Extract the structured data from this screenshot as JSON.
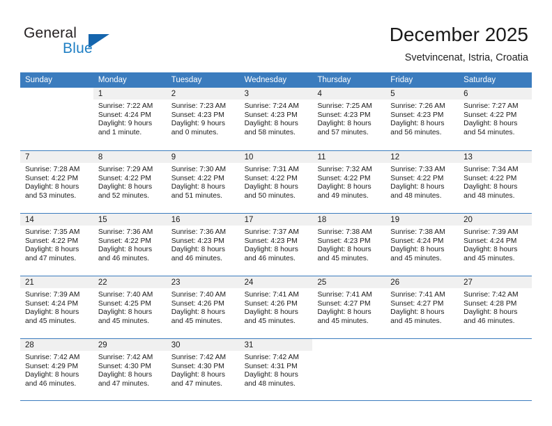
{
  "logo": {
    "word1": "General",
    "word2": "Blue",
    "triangle_color": "#1565ad",
    "blue_text_color": "#1f7fc4"
  },
  "header": {
    "title": "December 2025",
    "subtitle": "Svetvincenat, Istria, Croatia"
  },
  "theme": {
    "header_blue": "#3b7cbe",
    "daynum_band": "#f0f0f0",
    "text": "#1a1a1a"
  },
  "weekday_headers": [
    "Sunday",
    "Monday",
    "Tuesday",
    "Wednesday",
    "Thursday",
    "Friday",
    "Saturday"
  ],
  "labels": {
    "sunrise": "Sunrise:",
    "sunset": "Sunset:",
    "daylight": "Daylight:"
  },
  "weeks": [
    [
      {
        "day": "",
        "lines": []
      },
      {
        "day": "1",
        "lines": [
          "Sunrise: 7:22 AM",
          "Sunset: 4:24 PM",
          "Daylight: 9 hours",
          "and 1 minute."
        ]
      },
      {
        "day": "2",
        "lines": [
          "Sunrise: 7:23 AM",
          "Sunset: 4:23 PM",
          "Daylight: 9 hours",
          "and 0 minutes."
        ]
      },
      {
        "day": "3",
        "lines": [
          "Sunrise: 7:24 AM",
          "Sunset: 4:23 PM",
          "Daylight: 8 hours",
          "and 58 minutes."
        ]
      },
      {
        "day": "4",
        "lines": [
          "Sunrise: 7:25 AM",
          "Sunset: 4:23 PM",
          "Daylight: 8 hours",
          "and 57 minutes."
        ]
      },
      {
        "day": "5",
        "lines": [
          "Sunrise: 7:26 AM",
          "Sunset: 4:23 PM",
          "Daylight: 8 hours",
          "and 56 minutes."
        ]
      },
      {
        "day": "6",
        "lines": [
          "Sunrise: 7:27 AM",
          "Sunset: 4:22 PM",
          "Daylight: 8 hours",
          "and 54 minutes."
        ]
      }
    ],
    [
      {
        "day": "7",
        "lines": [
          "Sunrise: 7:28 AM",
          "Sunset: 4:22 PM",
          "Daylight: 8 hours",
          "and 53 minutes."
        ]
      },
      {
        "day": "8",
        "lines": [
          "Sunrise: 7:29 AM",
          "Sunset: 4:22 PM",
          "Daylight: 8 hours",
          "and 52 minutes."
        ]
      },
      {
        "day": "9",
        "lines": [
          "Sunrise: 7:30 AM",
          "Sunset: 4:22 PM",
          "Daylight: 8 hours",
          "and 51 minutes."
        ]
      },
      {
        "day": "10",
        "lines": [
          "Sunrise: 7:31 AM",
          "Sunset: 4:22 PM",
          "Daylight: 8 hours",
          "and 50 minutes."
        ]
      },
      {
        "day": "11",
        "lines": [
          "Sunrise: 7:32 AM",
          "Sunset: 4:22 PM",
          "Daylight: 8 hours",
          "and 49 minutes."
        ]
      },
      {
        "day": "12",
        "lines": [
          "Sunrise: 7:33 AM",
          "Sunset: 4:22 PM",
          "Daylight: 8 hours",
          "and 48 minutes."
        ]
      },
      {
        "day": "13",
        "lines": [
          "Sunrise: 7:34 AM",
          "Sunset: 4:22 PM",
          "Daylight: 8 hours",
          "and 48 minutes."
        ]
      }
    ],
    [
      {
        "day": "14",
        "lines": [
          "Sunrise: 7:35 AM",
          "Sunset: 4:22 PM",
          "Daylight: 8 hours",
          "and 47 minutes."
        ]
      },
      {
        "day": "15",
        "lines": [
          "Sunrise: 7:36 AM",
          "Sunset: 4:22 PM",
          "Daylight: 8 hours",
          "and 46 minutes."
        ]
      },
      {
        "day": "16",
        "lines": [
          "Sunrise: 7:36 AM",
          "Sunset: 4:23 PM",
          "Daylight: 8 hours",
          "and 46 minutes."
        ]
      },
      {
        "day": "17",
        "lines": [
          "Sunrise: 7:37 AM",
          "Sunset: 4:23 PM",
          "Daylight: 8 hours",
          "and 46 minutes."
        ]
      },
      {
        "day": "18",
        "lines": [
          "Sunrise: 7:38 AM",
          "Sunset: 4:23 PM",
          "Daylight: 8 hours",
          "and 45 minutes."
        ]
      },
      {
        "day": "19",
        "lines": [
          "Sunrise: 7:38 AM",
          "Sunset: 4:24 PM",
          "Daylight: 8 hours",
          "and 45 minutes."
        ]
      },
      {
        "day": "20",
        "lines": [
          "Sunrise: 7:39 AM",
          "Sunset: 4:24 PM",
          "Daylight: 8 hours",
          "and 45 minutes."
        ]
      }
    ],
    [
      {
        "day": "21",
        "lines": [
          "Sunrise: 7:39 AM",
          "Sunset: 4:24 PM",
          "Daylight: 8 hours",
          "and 45 minutes."
        ]
      },
      {
        "day": "22",
        "lines": [
          "Sunrise: 7:40 AM",
          "Sunset: 4:25 PM",
          "Daylight: 8 hours",
          "and 45 minutes."
        ]
      },
      {
        "day": "23",
        "lines": [
          "Sunrise: 7:40 AM",
          "Sunset: 4:26 PM",
          "Daylight: 8 hours",
          "and 45 minutes."
        ]
      },
      {
        "day": "24",
        "lines": [
          "Sunrise: 7:41 AM",
          "Sunset: 4:26 PM",
          "Daylight: 8 hours",
          "and 45 minutes."
        ]
      },
      {
        "day": "25",
        "lines": [
          "Sunrise: 7:41 AM",
          "Sunset: 4:27 PM",
          "Daylight: 8 hours",
          "and 45 minutes."
        ]
      },
      {
        "day": "26",
        "lines": [
          "Sunrise: 7:41 AM",
          "Sunset: 4:27 PM",
          "Daylight: 8 hours",
          "and 45 minutes."
        ]
      },
      {
        "day": "27",
        "lines": [
          "Sunrise: 7:42 AM",
          "Sunset: 4:28 PM",
          "Daylight: 8 hours",
          "and 46 minutes."
        ]
      }
    ],
    [
      {
        "day": "28",
        "lines": [
          "Sunrise: 7:42 AM",
          "Sunset: 4:29 PM",
          "Daylight: 8 hours",
          "and 46 minutes."
        ]
      },
      {
        "day": "29",
        "lines": [
          "Sunrise: 7:42 AM",
          "Sunset: 4:30 PM",
          "Daylight: 8 hours",
          "and 47 minutes."
        ]
      },
      {
        "day": "30",
        "lines": [
          "Sunrise: 7:42 AM",
          "Sunset: 4:30 PM",
          "Daylight: 8 hours",
          "and 47 minutes."
        ]
      },
      {
        "day": "31",
        "lines": [
          "Sunrise: 7:42 AM",
          "Sunset: 4:31 PM",
          "Daylight: 8 hours",
          "and 48 minutes."
        ]
      },
      {
        "day": "",
        "lines": []
      },
      {
        "day": "",
        "lines": []
      },
      {
        "day": "",
        "lines": []
      }
    ]
  ]
}
